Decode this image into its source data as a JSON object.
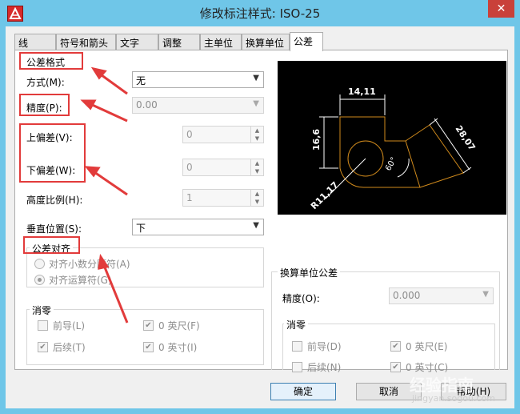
{
  "window": {
    "title": "修改标注样式: ISO-25",
    "close_glyph": "✕",
    "app_icon": "autocad-icon"
  },
  "tabs": [
    "线",
    "符号和箭头",
    "文字",
    "调整",
    "主单位",
    "换算单位",
    "公差"
  ],
  "active_tab": "公差",
  "tolerance_format": {
    "title": "公差格式",
    "method_label": "方式(M):",
    "method_value": "无",
    "precision_label": "精度(P):",
    "precision_value": "0.00",
    "upper_label": "上偏差(V):",
    "upper_value": "0",
    "lower_label": "下偏差(W):",
    "lower_value": "0",
    "scale_label": "高度比例(H):",
    "scale_value": "1",
    "vpos_label": "垂直位置(S):",
    "vpos_value": "下"
  },
  "tolerance_align": {
    "title": "公差对齐",
    "opt_decimal": "对齐小数分隔符(A)",
    "opt_operator": "对齐运算符(G)",
    "selected": "对齐运算符(G)"
  },
  "zero_suppress": {
    "title": "消零",
    "leading": "前导(L)",
    "leading_checked": false,
    "trailing": "后续(T)",
    "trailing_checked": true,
    "feet": "0 英尺(F)",
    "feet_checked": true,
    "inches": "0 英寸(I)",
    "inches_checked": true
  },
  "alt_tolerance": {
    "title": "换算单位公差",
    "precision_label": "精度(O):",
    "precision_value": "0.000",
    "zero_title": "消零",
    "leading": "前导(D)",
    "leading_checked": false,
    "trailing": "后续(N)",
    "trailing_checked": false,
    "feet": "0 英尺(E)",
    "feet_checked": true,
    "inches": "0 英寸(C)",
    "inches_checked": true
  },
  "preview": {
    "dim_top": "14,11",
    "dim_left": "16,6",
    "dim_diag": "28,07",
    "dim_angle": "60°",
    "dim_radius": "R11,17"
  },
  "buttons": {
    "ok": "确定",
    "cancel": "取消",
    "help": "帮助(H)"
  },
  "watermark": {
    "text": "经验指南",
    "url": "jingyan.sogou.com"
  },
  "colors": {
    "titlebar": "#6fc6e8",
    "annotation_red": "#e23b3b",
    "preview_bg": "#000000",
    "preview_line": "#d08a1c"
  }
}
